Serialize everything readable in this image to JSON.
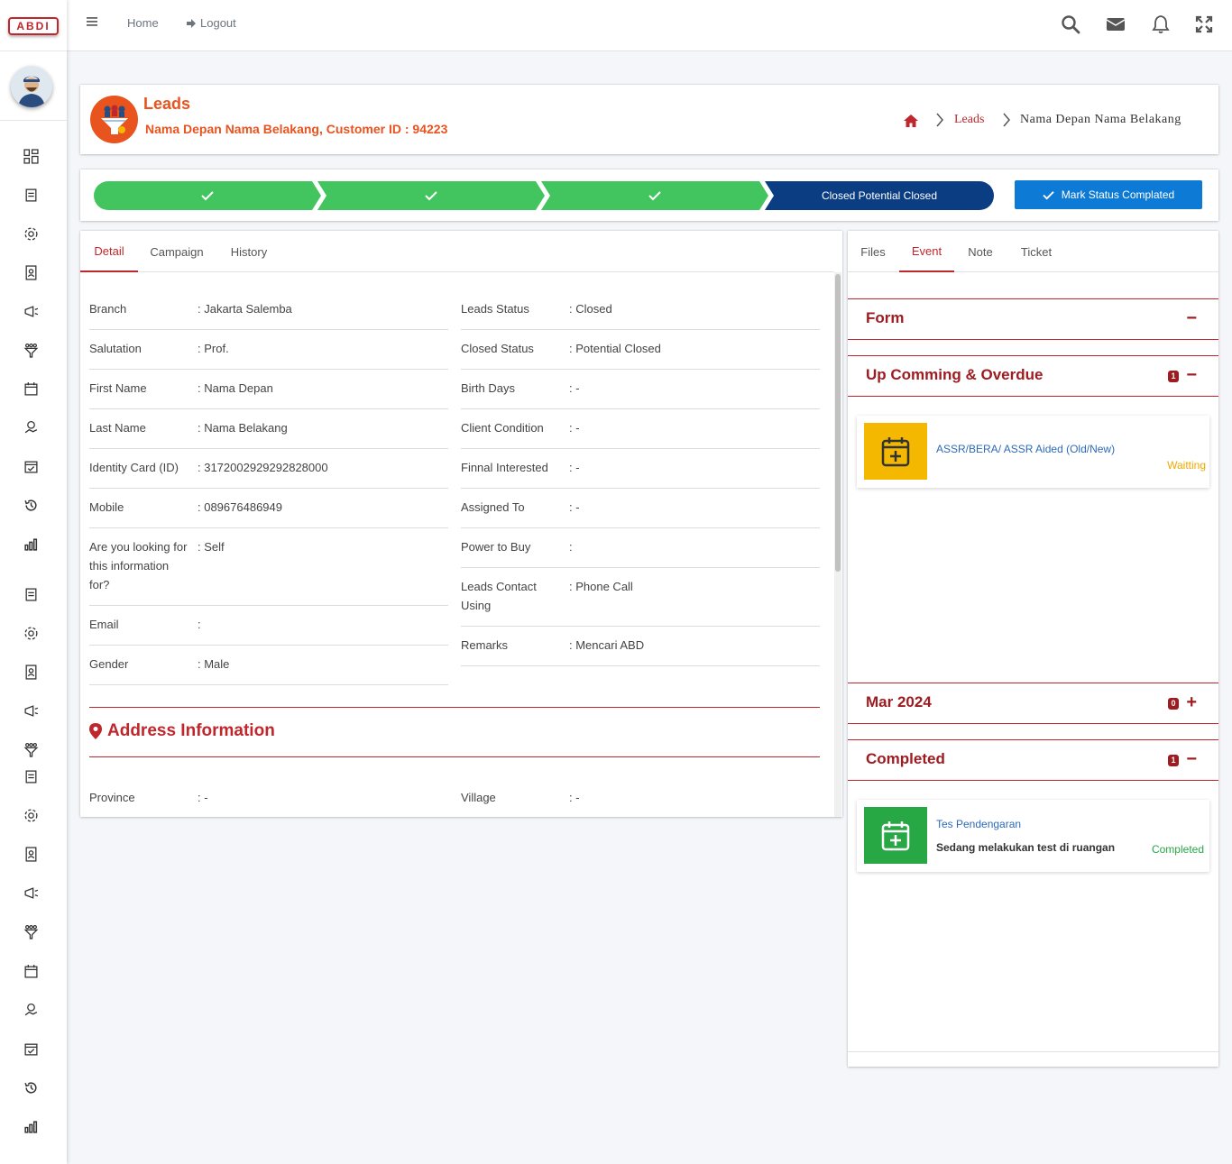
{
  "brand": {
    "logo_text": "ABDI"
  },
  "topbar": {
    "home_label": "Home",
    "logout_label": "Logout"
  },
  "header": {
    "title": "Leads",
    "subtitle": "Nama Depan Nama Belakang, Customer ID : 94223",
    "breadcrumb": [
      "Leads",
      "Nama Depan Nama Belakang"
    ]
  },
  "status_bar": {
    "current_step": "Closed Potential Closed",
    "mark_button": "Mark Status Complated",
    "completed_steps": 3
  },
  "detail_tabs": [
    "Detail",
    "Campaign",
    "History"
  ],
  "detail_left": [
    {
      "label": "Branch",
      "value": ": Jakarta Salemba"
    },
    {
      "label": "Salutation",
      "value": ": Prof."
    },
    {
      "label": "First Name",
      "value": ": Nama Depan"
    },
    {
      "label": "Last Name",
      "value": ": Nama Belakang"
    },
    {
      "label": "Identity Card (ID)",
      "value": ": 3172002929292828000"
    },
    {
      "label": "Mobile",
      "value": ": 089676486949"
    },
    {
      "label": "Are you looking for this information for?",
      "value": ": Self"
    },
    {
      "label": "Email",
      "value": ":"
    },
    {
      "label": "Gender",
      "value": ": Male"
    }
  ],
  "detail_right": [
    {
      "label": "Leads Status",
      "value": ": Closed"
    },
    {
      "label": "Closed Status",
      "value": ": Potential Closed"
    },
    {
      "label": "Birth Days",
      "value": ": -"
    },
    {
      "label": "Client Condition",
      "value": ": -"
    },
    {
      "label": "Finnal Interested",
      "value": ": -"
    },
    {
      "label": "Assigned To",
      "value": ": -"
    },
    {
      "label": "Power to Buy",
      "value": ":"
    },
    {
      "label": "Leads Contact Using",
      "value": ": Phone Call"
    },
    {
      "label": "Remarks",
      "value": ": Mencari ABD"
    }
  ],
  "address": {
    "title": "Address Information",
    "province_label": "Province",
    "province_value": ": -",
    "village_label": "Village",
    "village_value": ": -"
  },
  "side_tabs": [
    "Files",
    "Event",
    "Note",
    "Ticket"
  ],
  "sections": {
    "form": {
      "title": "Form",
      "toggle": "−"
    },
    "upcoming": {
      "title": "Up Comming & Overdue",
      "count": "1",
      "toggle": "−"
    },
    "month": {
      "title": "Mar 2024",
      "count": "0",
      "toggle": "+"
    },
    "completed": {
      "title": "Completed",
      "count": "1",
      "toggle": "−"
    }
  },
  "events": {
    "upcoming": {
      "title": "ASSR/BERA/ ASSR Aided (Old/New)",
      "status": "Waitting",
      "color": "#f5b800",
      "icon": "calendar-plus-icon"
    },
    "completed": {
      "title": "Tes Pendengaran",
      "desc": "Sedang melakukan test di ruangan",
      "status": "Completed",
      "color": "#28a745",
      "icon": "calendar-plus-icon"
    }
  },
  "colors": {
    "accent": "#c0272d",
    "orange": "#e8531e",
    "green": "#42c55e",
    "navy": "#0b3d82",
    "blue": "#0d7ad6"
  }
}
